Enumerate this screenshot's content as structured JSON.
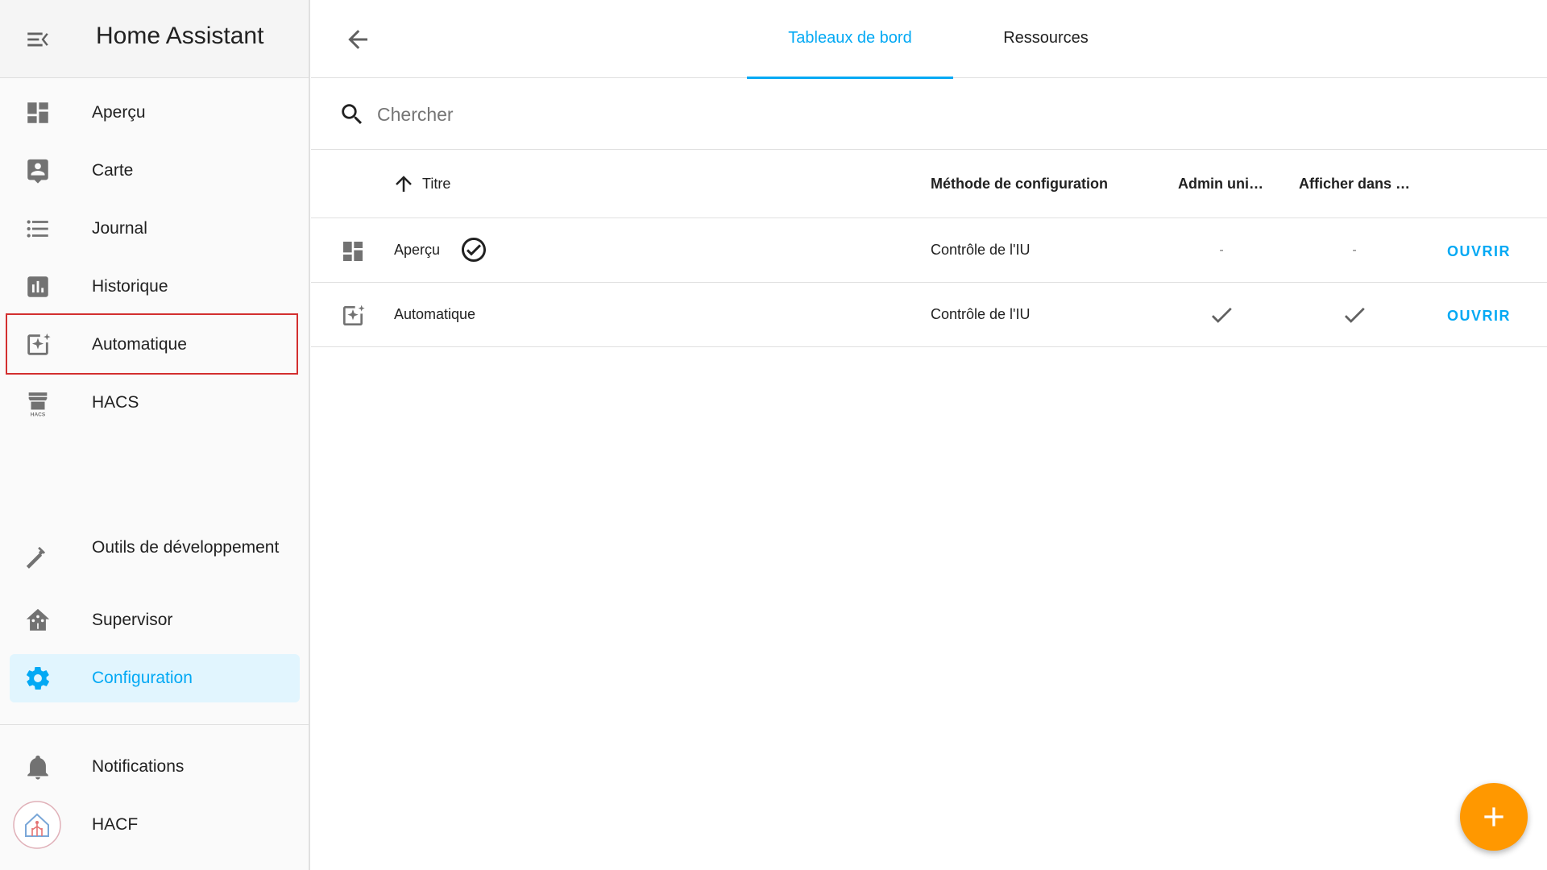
{
  "app": {
    "title": "Home Assistant"
  },
  "sidebar": {
    "items": [
      {
        "label": "Aperçu",
        "icon": "view-dashboard-icon"
      },
      {
        "label": "Carte",
        "icon": "account-box-icon"
      },
      {
        "label": "Journal",
        "icon": "format-list-bulleted-icon"
      },
      {
        "label": "Historique",
        "icon": "chart-box-icon"
      },
      {
        "label": "Automatique",
        "icon": "view-dashboard-variant-icon"
      },
      {
        "label": "HACS",
        "icon": "hacs-icon"
      }
    ],
    "bottom_items": [
      {
        "label": "Outils de développement",
        "icon": "hammer-icon"
      },
      {
        "label": "Supervisor",
        "icon": "home-assistant-icon"
      },
      {
        "label": "Configuration",
        "icon": "cog-icon",
        "active": true
      }
    ],
    "footer_items": [
      {
        "label": "Notifications",
        "icon": "bell-icon"
      },
      {
        "label": "HACF",
        "icon": "avatar"
      }
    ]
  },
  "tabs": [
    {
      "label": "Tableaux de bord",
      "active": true
    },
    {
      "label": "Ressources",
      "active": false
    }
  ],
  "search": {
    "placeholder": "Chercher",
    "value": ""
  },
  "table": {
    "columns": [
      "Titre",
      "Méthode de configuration",
      "Admin uni…",
      "Afficher dans …"
    ],
    "sort": {
      "column": "Titre",
      "direction": "ascending"
    },
    "rows": [
      {
        "title": "Aperçu",
        "is_default": true,
        "method": "Contrôle de l'IU",
        "admin_only": "-",
        "show_in_sidebar": "-",
        "action": "OUVRIR"
      },
      {
        "title": "Automatique",
        "is_default": false,
        "method": "Contrôle de l'IU",
        "admin_only": "check",
        "show_in_sidebar": "check",
        "action": "OUVRIR"
      }
    ]
  },
  "colors": {
    "accent": "#03a9f4",
    "fab": "#ff9800",
    "highlight": "#d32f2f",
    "active_bg": "#e1f5fe"
  }
}
